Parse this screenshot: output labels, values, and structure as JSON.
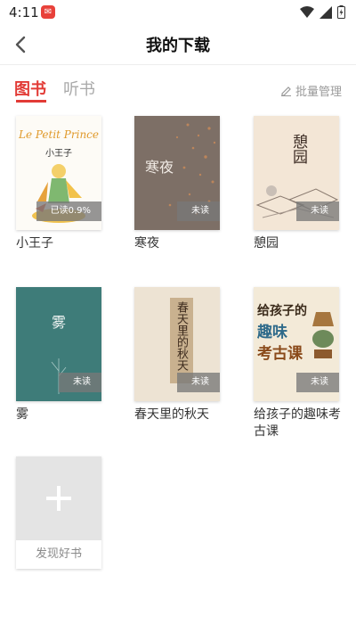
{
  "status": {
    "time": "4:11"
  },
  "header": {
    "title": "我的下载"
  },
  "tabs": {
    "books": "图书",
    "audio": "听书",
    "manage": "批量管理"
  },
  "books": [
    {
      "title": "小王子",
      "status": "已读0.9%",
      "cover_title": "小王子",
      "cover_script": "Le Petit Prince"
    },
    {
      "title": "寒夜",
      "status": "未读",
      "cover_title": "寒夜"
    },
    {
      "title": "憩园",
      "status": "未读",
      "cover_title": "憩园"
    },
    {
      "title": "雾",
      "status": "未读",
      "cover_title": "雾"
    },
    {
      "title": "春天里的秋天",
      "status": "未读",
      "cover_title": "春天里的秋天"
    },
    {
      "title": "给孩子的趣味考古课",
      "status": "未读",
      "cover_line1": "给孩子的",
      "cover_line2": "趣味",
      "cover_line3": "考古课"
    }
  ],
  "add": {
    "label": "发现好书"
  },
  "colors": {
    "accent": "#e23b36"
  }
}
